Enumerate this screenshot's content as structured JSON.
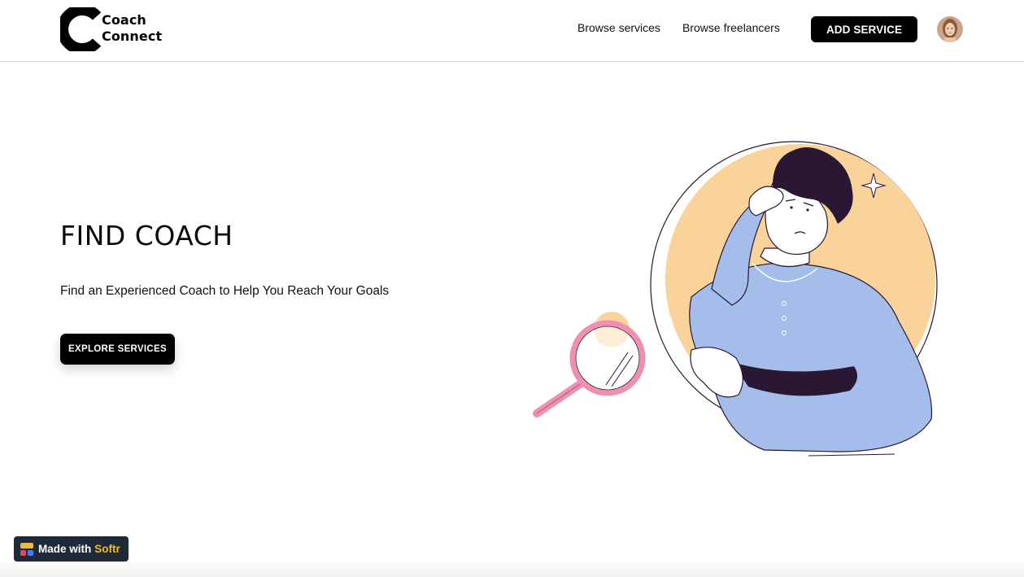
{
  "header": {
    "logo_line1": "Coach",
    "logo_line2": "Connect",
    "nav": {
      "browse_services": "Browse services",
      "browse_freelancers": "Browse freelancers"
    },
    "add_service_label": "ADD SERVICE"
  },
  "hero": {
    "title": "FIND COACH",
    "subtitle": "Find an Experienced Coach to Help You Reach Your Goals",
    "cta_label": "EXPLORE SERVICES"
  },
  "badge": {
    "prefix": "Made with",
    "brand": "Softr"
  },
  "colors": {
    "accent": "#000000",
    "illustration_circle": "#f9d39a",
    "shirt": "#a4bdea",
    "hair": "#2a1733",
    "magnifier": "#ef8fb2",
    "badge_bg": "#1e2a38",
    "badge_accent": "#f5b82e"
  },
  "icons": [
    "coach-connect-logo-mark",
    "user-avatar",
    "softr-logo-icon"
  ]
}
